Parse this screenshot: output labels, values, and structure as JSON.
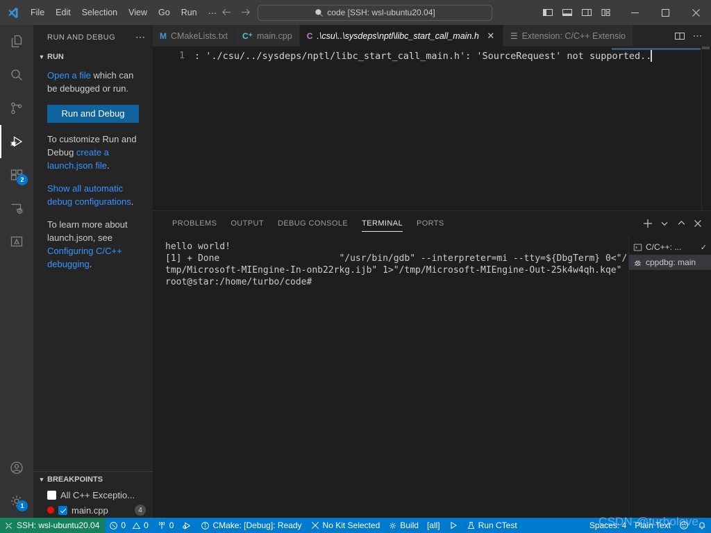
{
  "titlebar": {
    "menus": [
      "File",
      "Edit",
      "Selection",
      "View",
      "Go",
      "Run",
      "⋯"
    ],
    "command_center_text": "code [SSH: wsl-ubuntu20.04]",
    "back_icon": "arrow-left-icon",
    "forward_icon": "arrow-right-icon",
    "search_icon": "search-icon",
    "layout_buttons": [
      "toggle-primary-sidebar-icon",
      "toggle-panel-icon",
      "toggle-secondary-sidebar-icon",
      "customize-layout-icon"
    ],
    "window_buttons": [
      "minimize",
      "maximize",
      "close"
    ]
  },
  "activitybar": {
    "items": [
      {
        "name": "explorer",
        "icon": "files-icon",
        "badge": null,
        "active": false
      },
      {
        "name": "search",
        "icon": "search-icon",
        "badge": null,
        "active": false
      },
      {
        "name": "source-control",
        "icon": "source-control-icon",
        "badge": null,
        "active": false
      },
      {
        "name": "run-and-debug",
        "icon": "run-and-debug-icon",
        "badge": null,
        "active": true
      },
      {
        "name": "extensions",
        "icon": "extensions-icon",
        "badge": "2",
        "active": false
      },
      {
        "name": "remote-explorer",
        "icon": "remote-explorer-icon",
        "badge": null,
        "active": false
      },
      {
        "name": "testing",
        "icon": "testing-beaker-icon",
        "badge": null,
        "active": false
      }
    ],
    "bottom": [
      {
        "name": "accounts",
        "icon": "account-icon",
        "badge": null
      },
      {
        "name": "manage",
        "icon": "gear-icon",
        "badge": "1"
      }
    ]
  },
  "sidebar": {
    "title": "RUN AND DEBUG",
    "more_actions": "⋯",
    "run_section": {
      "label": "RUN",
      "expanded": true
    },
    "welcome": {
      "line1_link": "Open a file",
      "line1_rest": " which can be debugged or run.",
      "run_debug_button": "Run and Debug",
      "line2_pre": "To customize Run and Debug ",
      "line2_link": "create a launch.json file",
      "line2_post": ".",
      "line3_link": "Show all automatic debug configurations",
      "line3_post": ".",
      "line4_pre": "To learn more about launch.json, see ",
      "line4_link": "Configuring C/C++ debugging",
      "line4_post": "."
    },
    "breakpoints": {
      "label": "BREAKPOINTS",
      "rows": [
        {
          "name": "all-cpp-exceptions",
          "text": "All C++ Exceptio...",
          "checked": false,
          "checkbox_style": "white",
          "has_dot": false,
          "count": null
        },
        {
          "name": "main-cpp",
          "text": "main.cpp",
          "checked": true,
          "checkbox_style": "blue",
          "has_dot": true,
          "count": "4"
        }
      ]
    }
  },
  "tabs": [
    {
      "name": "cmakelists-txt",
      "label": "CMakeLists.txt",
      "icon": "M",
      "icon_color": "#3b9ad9",
      "active": false,
      "italic": false,
      "closable": false
    },
    {
      "name": "main-cpp",
      "label": "main.cpp",
      "icon": "C⁺",
      "icon_color": "#4ec9d8",
      "active": false,
      "italic": false,
      "closable": false
    },
    {
      "name": "libc-start-call-main-h",
      "label": ".\\csu\\..\\sysdeps\\nptl\\libc_start_call_main.h",
      "icon": "C",
      "icon_color": "#c586c0",
      "active": true,
      "italic": true,
      "closable": true
    },
    {
      "name": "extension-c-cpp",
      "label": "Extension: C/C++ Extensio",
      "icon": "☰",
      "icon_color": "#9d9d9d",
      "active": false,
      "italic": false,
      "closable": false
    }
  ],
  "tab_actions": {
    "split_editor": "split-editor-icon",
    "more": "⋯"
  },
  "editor": {
    "line_number": "1",
    "text": ": './csu/../sysdeps/nptl/libc_start_call_main.h': 'SourceRequest' not supported..",
    "has_caret": true
  },
  "panel": {
    "tabs": [
      {
        "name": "problems",
        "label": "PROBLEMS",
        "active": false
      },
      {
        "name": "output",
        "label": "OUTPUT",
        "active": false
      },
      {
        "name": "debug-console",
        "label": "DEBUG CONSOLE",
        "active": false
      },
      {
        "name": "terminal",
        "label": "TERMINAL",
        "active": true
      },
      {
        "name": "ports",
        "label": "PORTS",
        "active": false
      }
    ],
    "actions": [
      "new-terminal-icon",
      "chevron-down-icon",
      "maximize-panel-icon",
      "close-panel-icon"
    ],
    "terminal_output": "hello world!\n[1] + Done                      \"/usr/bin/gdb\" --interpreter=mi --tty=${DbgTerm} 0<\"/tmp/Microsoft-MIEngine-In-onb22rkg.ijb\" 1>\"/tmp/Microsoft-MIEngine-Out-25k4w4qh.kqe\"\nroot@star:/home/turbo/code# ",
    "terminal_list": [
      {
        "name": "c-cpp-task",
        "label": "C/C++: ...",
        "icon": "terminal-icon",
        "active": false,
        "tick": "✓"
      },
      {
        "name": "cppdbg-main",
        "label": "cppdbg: main",
        "icon": "debug-bug-icon",
        "active": true,
        "tick": ""
      }
    ]
  },
  "statusbar": {
    "remote": {
      "icon": "remote-icon",
      "label": "SSH: wsl-ubuntu20.04"
    },
    "left_items": [
      {
        "name": "problems-count",
        "icon": "error-icon",
        "label": "0",
        "icon2": "warning-icon",
        "label2": "0"
      },
      {
        "name": "radio-tower",
        "icon": "radio-tower-icon",
        "label": "0"
      },
      {
        "name": "debug-alt",
        "icon": "debug-alt-icon",
        "label": ""
      },
      {
        "name": "cmake-status",
        "icon": "info-icon",
        "label": "CMake: [Debug]: Ready"
      },
      {
        "name": "kit-select",
        "icon": "tools-icon",
        "label": "No Kit Selected"
      },
      {
        "name": "build",
        "icon": "gear-icon",
        "label": "Build"
      },
      {
        "name": "build-target",
        "icon": "",
        "label": "[all]"
      },
      {
        "name": "launch",
        "icon": "play-icon",
        "label": ""
      },
      {
        "name": "run-ctest",
        "icon": "beaker-icon",
        "label": "Run CTest"
      }
    ],
    "right_items": [
      {
        "name": "indentation",
        "label": "Spaces: 4"
      },
      {
        "name": "language-mode",
        "label": "Plain Text"
      },
      {
        "name": "feedback",
        "label": "",
        "icon": "feedback-smiley-icon"
      },
      {
        "name": "notifications",
        "label": "",
        "icon": "bell-icon"
      }
    ]
  },
  "watermark": "CSDN-@turbolove",
  "colors": {
    "accent": "#007acc",
    "remote_green": "#16825d",
    "button_blue": "#0e639c",
    "link_blue": "#3794ff",
    "badge_blue": "#0078d4",
    "breakpoint_red": "#e51400"
  }
}
